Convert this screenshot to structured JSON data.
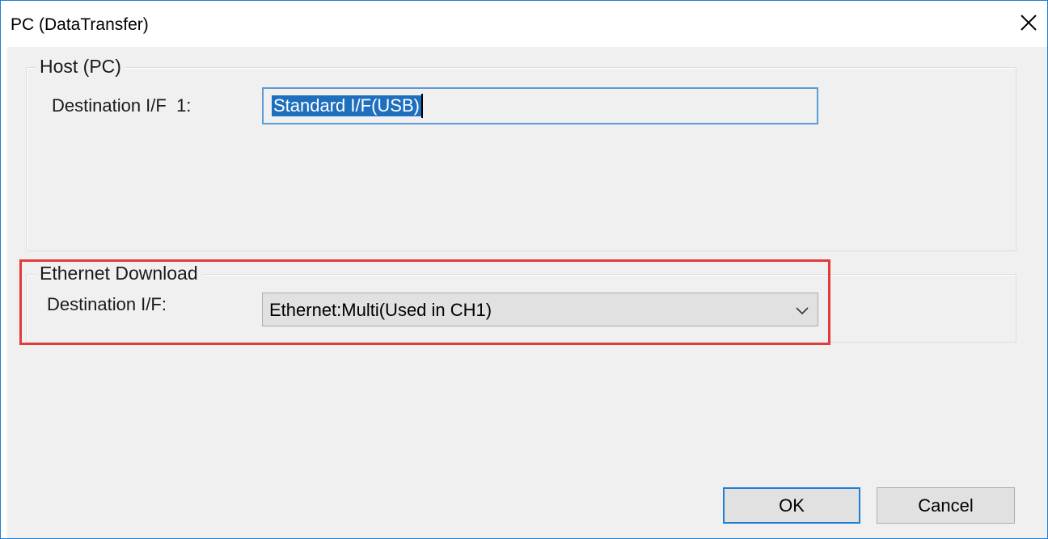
{
  "window": {
    "title": "PC (DataTransfer)"
  },
  "host_group": {
    "legend": "Host (PC)",
    "destination_label": "Destination I/F  1:",
    "destination_value": "Standard I/F(USB)"
  },
  "ethernet_group": {
    "legend": "Ethernet Download",
    "destination_label": "Destination I/F:",
    "destination_selected": "Ethernet:Multi(Used in CH1)"
  },
  "buttons": {
    "ok": "OK",
    "cancel": "Cancel"
  },
  "colors": {
    "window_border": "#1e7fd6",
    "highlight": "#e23b3b",
    "selection": "#1f6fbf"
  }
}
